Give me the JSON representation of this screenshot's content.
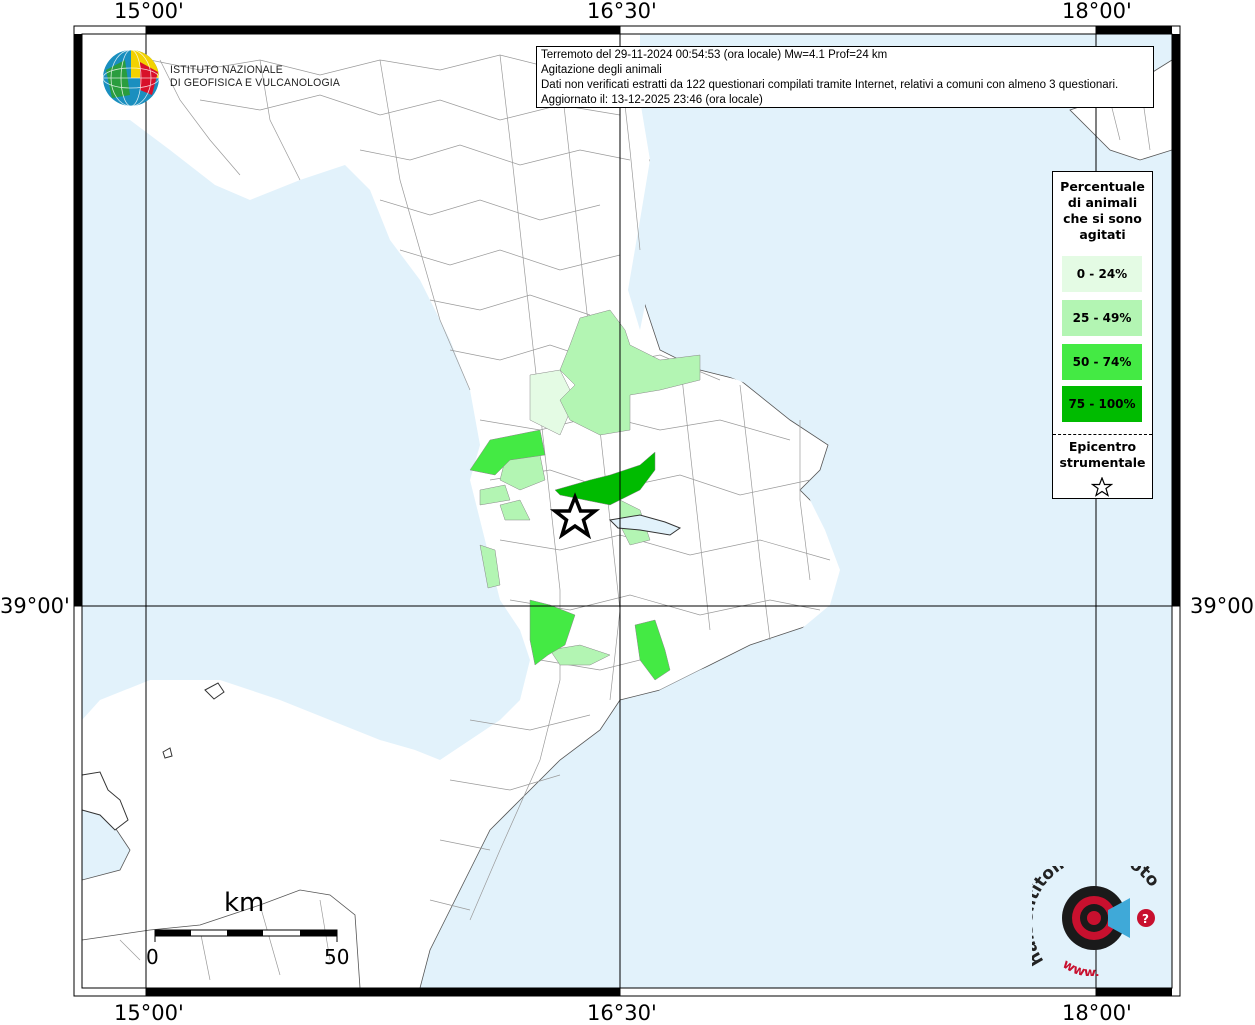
{
  "info": {
    "line1": "Terremoto del 29-11-2024 00:54:53 (ora locale) Mw=4.1 Prof=24 km",
    "line2": "Agitazione degli animali",
    "line3": "Dati non verificati estratti da 122 questionari compilati tramite Internet, relativi a comuni con almeno 3 questionari.",
    "line4": "Aggiornato il: 13-12-2025 23:46 (ora locale)"
  },
  "axes": {
    "top": [
      "15°00'",
      "16°30'",
      "18°00'"
    ],
    "bottom": [
      "15°00'",
      "16°30'",
      "18°00'"
    ],
    "left": "39°00'",
    "right": "39°00'"
  },
  "logo": {
    "line1": "ISTITUTO NAZIONALE",
    "line2": "DI GEOFISICA E VULCANOLOGIA"
  },
  "legend": {
    "title_lines": [
      "Percentuale",
      "di animali",
      "che si sono",
      "agitati"
    ],
    "items": [
      {
        "label": "0 - 24%",
        "color": "#e4fbe4"
      },
      {
        "label": "25 - 49%",
        "color": "#b3f5b3"
      },
      {
        "label": "50 - 74%",
        "color": "#44ea44"
      },
      {
        "label": "75 - 100%",
        "color": "#00bb00"
      }
    ],
    "epicenter_lines": [
      "Epicentro",
      "strumentale"
    ]
  },
  "scale": {
    "unit": "km",
    "start": "0",
    "end": "50"
  },
  "colors": {
    "sea": "#e2f2fb",
    "land": "#ffffff",
    "grid": "#000000"
  },
  "brand": {
    "text": "haisentitoilterremoto.it",
    "url_prefix": "www."
  }
}
